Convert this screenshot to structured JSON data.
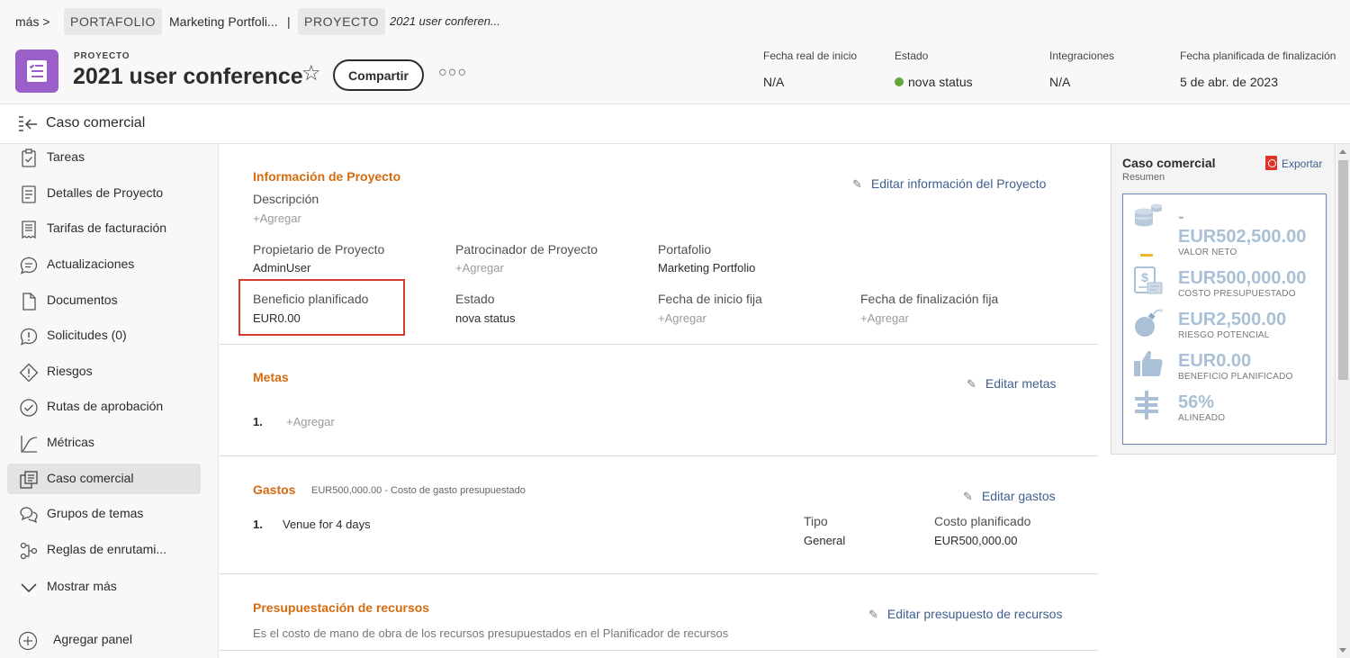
{
  "breadcrumb": {
    "more": "más >",
    "portfolio_tag": "PORTAFOLIO",
    "portfolio_name": "Marketing Portfoli...",
    "separator": "|",
    "project_tag": "PROYECTO",
    "project_name": "2021 user conferen..."
  },
  "header": {
    "kind": "PROYECTO",
    "title": "2021 user conference",
    "share_label": "Compartir",
    "more_label": "○○○",
    "meta": [
      {
        "label": "Fecha real de inicio",
        "value": "N/A"
      },
      {
        "label": "Estado",
        "value": "nova status",
        "status_color": "#63a63c"
      },
      {
        "label": "Integraciones",
        "value": "N/A"
      },
      {
        "label": "Fecha planificada de finalización",
        "value": "5 de abr. de 2023"
      }
    ]
  },
  "section": {
    "title": "Caso comercial"
  },
  "sidebar": {
    "items": [
      {
        "label": "Tareas",
        "icon": "task-icon"
      },
      {
        "label": "Detalles de Proyecto",
        "icon": "details-icon"
      },
      {
        "label": "Tarifas de facturación",
        "icon": "billing-icon"
      },
      {
        "label": "Actualizaciones",
        "icon": "updates-icon"
      },
      {
        "label": "Documentos",
        "icon": "document-icon"
      },
      {
        "label": "Solicitudes (0)",
        "icon": "requests-icon"
      },
      {
        "label": "Riesgos",
        "icon": "risk-icon"
      },
      {
        "label": "Rutas de aprobación",
        "icon": "approval-icon"
      },
      {
        "label": "Métricas",
        "icon": "metrics-icon"
      },
      {
        "label": "Caso comercial",
        "icon": "business-case-icon",
        "active": true
      },
      {
        "label": "Grupos de temas",
        "icon": "topic-groups-icon"
      },
      {
        "label": "Reglas de enrutami...",
        "icon": "routing-icon"
      },
      {
        "label": "Mostrar más",
        "icon": "chevron-down-icon"
      }
    ],
    "add_panel": "Agregar panel"
  },
  "main": {
    "info": {
      "heading": "Información de Proyecto",
      "edit": "Editar información del Proyecto",
      "description_label": "Descripción",
      "description_value": "+Agregar",
      "owner_label": "Propietario de Proyecto",
      "owner_value": "AdminUser",
      "sponsor_label": "Patrocinador de Proyecto",
      "sponsor_value": "+Agregar",
      "portfolio_label": "Portafolio",
      "portfolio_value": "Marketing Portfolio",
      "benefit_label": "Beneficio planificado",
      "benefit_value": "EUR0.00",
      "status_label": "Estado",
      "status_value": "nova status",
      "fixed_start_label": "Fecha de inicio fija",
      "fixed_start_value": "+Agregar",
      "fixed_end_label": "Fecha de finalización fija",
      "fixed_end_value": "+Agregar"
    },
    "goals": {
      "heading": "Metas",
      "edit": "Editar metas",
      "num": "1.",
      "add": "+Agregar"
    },
    "expenses": {
      "heading": "Gastos",
      "note": "EUR500,000.00 - Costo de gasto presupuestado",
      "edit": "Editar gastos",
      "num": "1.",
      "item": "Venue for 4 days",
      "type_label": "Tipo",
      "type_value": "General",
      "cost_label": "Costo planificado",
      "cost_value": "EUR500,000.00"
    },
    "resources": {
      "heading": "Presupuestación de recursos",
      "edit": "Editar presupuesto de recursos",
      "note": "Es el costo de mano de obra de los recursos presupuestados en el Planificador de recursos"
    }
  },
  "rpanel": {
    "title": "Caso comercial",
    "subtitle": "Resumen",
    "export": "Exportar",
    "metrics": [
      {
        "dash": "-",
        "value": "EUR502,500.00",
        "label": "VALOR NETO",
        "icon": "coins-icon"
      },
      {
        "value": "EUR500,000.00",
        "label": "COSTO PRESUPUESTADO",
        "icon": "invoice-icon"
      },
      {
        "value": "EUR2,500.00",
        "label": "RIESGO POTENCIAL",
        "icon": "bomb-icon"
      },
      {
        "value": "EUR0.00",
        "label": "BENEFICIO PLANIFICADO",
        "icon": "thumbs-up-icon"
      },
      {
        "value": "56%",
        "label": "ALINEADO",
        "icon": "alignment-icon"
      }
    ]
  },
  "colors": {
    "accent_orange": "#d46b0e",
    "link_blue": "#3f5f8f",
    "project_purple": "#9a5fc9",
    "highlight_red": "#d63a2c",
    "metric_blue": "#a9c0d6"
  }
}
